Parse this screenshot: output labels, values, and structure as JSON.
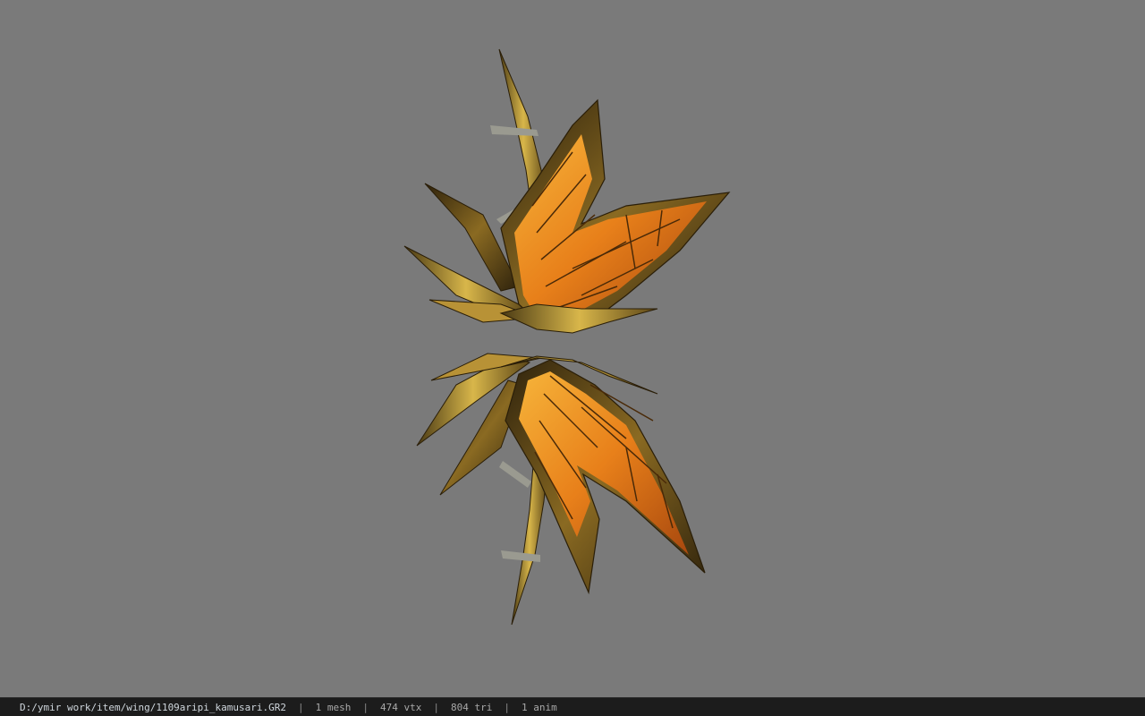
{
  "viewer": {
    "background_color": "#7a7a7a",
    "model_icon": "wing-model-icon"
  },
  "statusbar": {
    "file_path": "D:/ymir work/item/wing/1109aripi_kamusari.GR2",
    "separator": "|",
    "mesh_count": "1 mesh",
    "vertex_count": "474 vtx",
    "triangle_count": "804 tri",
    "anim_count": "1 anim"
  },
  "colors": {
    "wing_orange": "#e8801a",
    "wing_gold": "#c9a23a",
    "wing_dark": "#3a2a10",
    "bone_gray": "#9a9a90"
  }
}
